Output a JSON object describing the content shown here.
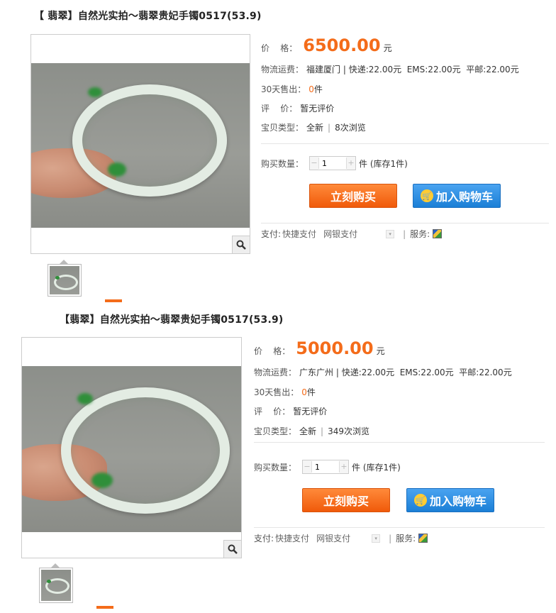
{
  "listings": [
    {
      "title": "【 翡翠】自然光实拍～翡翠贵妃手镯0517(53.9)",
      "price_label": "价    格：",
      "price": "6500.00",
      "price_unit": "元",
      "shipping_label": "物流运费：",
      "shipping_value": "福建厦门 | 快递:22.00元  EMS:22.00元  平邮:22.00元",
      "sold_label": "30天售出：",
      "sold_count": "0",
      "sold_unit": "件",
      "rating_label": "评    价：",
      "rating_value": "暂无评价",
      "type_label": "宝贝类型：",
      "type_value": "全新",
      "views": "8次浏览",
      "qty_label": "购买数量：",
      "qty_value": "1",
      "qty_unit": "件 (库存1件)",
      "buy_button": "立刻购买",
      "cart_button": "加入购物车",
      "pay_label": "支付:",
      "pay_method1": "快捷支付",
      "pay_method2": "网银支付",
      "service_label": "服务:"
    },
    {
      "title": "【翡翠】自然光实拍～翡翠贵妃手镯0517(53.9)",
      "price_label": "价    格：",
      "price": "5000.00",
      "price_unit": "元",
      "shipping_label": "物流运费：",
      "shipping_value": "广东广州 | 快递:22.00元  EMS:22.00元  平邮:22.00元",
      "sold_label": "30天售出：",
      "sold_count": "0",
      "sold_unit": "件",
      "rating_label": "评    价：",
      "rating_value": "暂无评价",
      "type_label": "宝贝类型：",
      "type_value": "全新",
      "views": "349次浏览",
      "qty_label": "购买数量：",
      "qty_value": "1",
      "qty_unit": "件 (库存1件)",
      "buy_button": "立刻购买",
      "cart_button": "加入购物车",
      "pay_label": "支付:",
      "pay_method1": "快捷支付",
      "pay_method2": "网银支付",
      "service_label": "服务:"
    }
  ],
  "colors": {
    "price": "#f46c1a",
    "buy_button": "#f46c1a",
    "cart_button": "#1b7fd6"
  }
}
